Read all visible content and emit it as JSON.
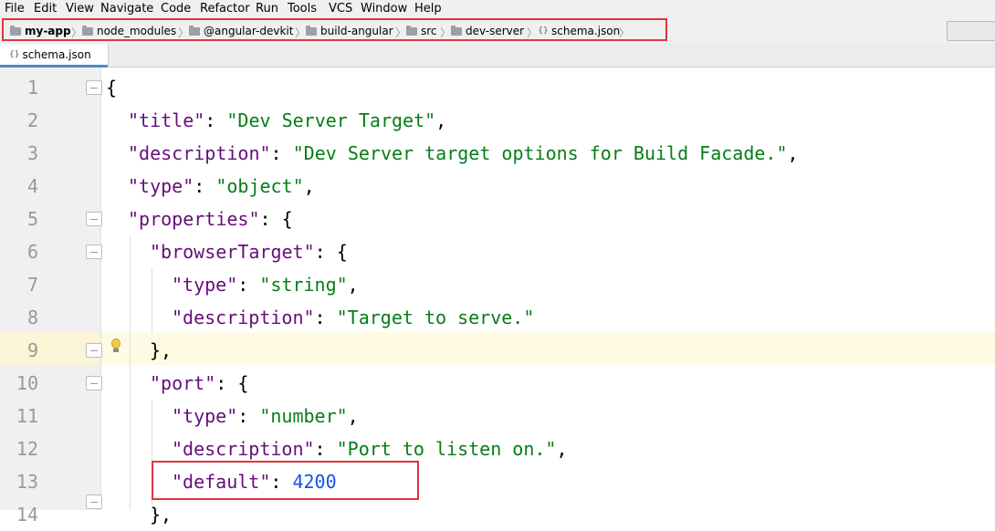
{
  "menu": [
    "File",
    "Edit",
    "View",
    "Navigate",
    "Code",
    "Refactor",
    "Run",
    "Tools",
    "VCS",
    "Window",
    "Help"
  ],
  "breadcrumb": [
    "my-app",
    "node_modules",
    "@angular-devkit",
    "build-angular",
    "src",
    "dev-server",
    "schema.json"
  ],
  "tab": {
    "label": "schema.json"
  },
  "editor": {
    "line_numbers": [
      "1",
      "2",
      "3",
      "4",
      "5",
      "6",
      "7",
      "8",
      "9",
      "10",
      "11",
      "12",
      "13",
      "14"
    ],
    "lines": [
      [
        {
          "t": "{",
          "c": "p"
        }
      ],
      [
        {
          "t": "\"title\"",
          "c": "k"
        },
        {
          "t": ": ",
          "c": "p"
        },
        {
          "t": "\"Dev Server Target\"",
          "c": "s"
        },
        {
          "t": ",",
          "c": "p"
        }
      ],
      [
        {
          "t": "\"description\"",
          "c": "k"
        },
        {
          "t": ": ",
          "c": "p"
        },
        {
          "t": "\"Dev Server target options for Build Facade.\"",
          "c": "s"
        },
        {
          "t": ",",
          "c": "p"
        }
      ],
      [
        {
          "t": "\"type\"",
          "c": "k"
        },
        {
          "t": ": ",
          "c": "p"
        },
        {
          "t": "\"object\"",
          "c": "s"
        },
        {
          "t": ",",
          "c": "p"
        }
      ],
      [
        {
          "t": "\"properties\"",
          "c": "k"
        },
        {
          "t": ": {",
          "c": "p"
        }
      ],
      [
        {
          "t": "\"browserTarget\"",
          "c": "k"
        },
        {
          "t": ": {",
          "c": "p"
        }
      ],
      [
        {
          "t": "\"type\"",
          "c": "k"
        },
        {
          "t": ": ",
          "c": "p"
        },
        {
          "t": "\"string\"",
          "c": "s"
        },
        {
          "t": ",",
          "c": "p"
        }
      ],
      [
        {
          "t": "\"description\"",
          "c": "k"
        },
        {
          "t": ": ",
          "c": "p"
        },
        {
          "t": "\"Target to serve.\"",
          "c": "s"
        }
      ],
      [
        {
          "t": "},",
          "c": "p"
        }
      ],
      [
        {
          "t": "\"port\"",
          "c": "k"
        },
        {
          "t": ": {",
          "c": "p"
        }
      ],
      [
        {
          "t": "\"type\"",
          "c": "k"
        },
        {
          "t": ": ",
          "c": "p"
        },
        {
          "t": "\"number\"",
          "c": "s"
        },
        {
          "t": ",",
          "c": "p"
        }
      ],
      [
        {
          "t": "\"description\"",
          "c": "k"
        },
        {
          "t": ": ",
          "c": "p"
        },
        {
          "t": "\"Port to listen on.\"",
          "c": "s"
        },
        {
          "t": ",",
          "c": "p"
        }
      ],
      [
        {
          "t": "\"default\"",
          "c": "k"
        },
        {
          "t": ": ",
          "c": "p"
        },
        {
          "t": "4200",
          "c": "n"
        }
      ],
      [
        {
          "t": "},",
          "c": "p"
        }
      ]
    ]
  },
  "colors": {
    "key": "#660e7a",
    "string": "#067d17",
    "number": "#1750eb",
    "highlight_box": "#e0353d"
  }
}
